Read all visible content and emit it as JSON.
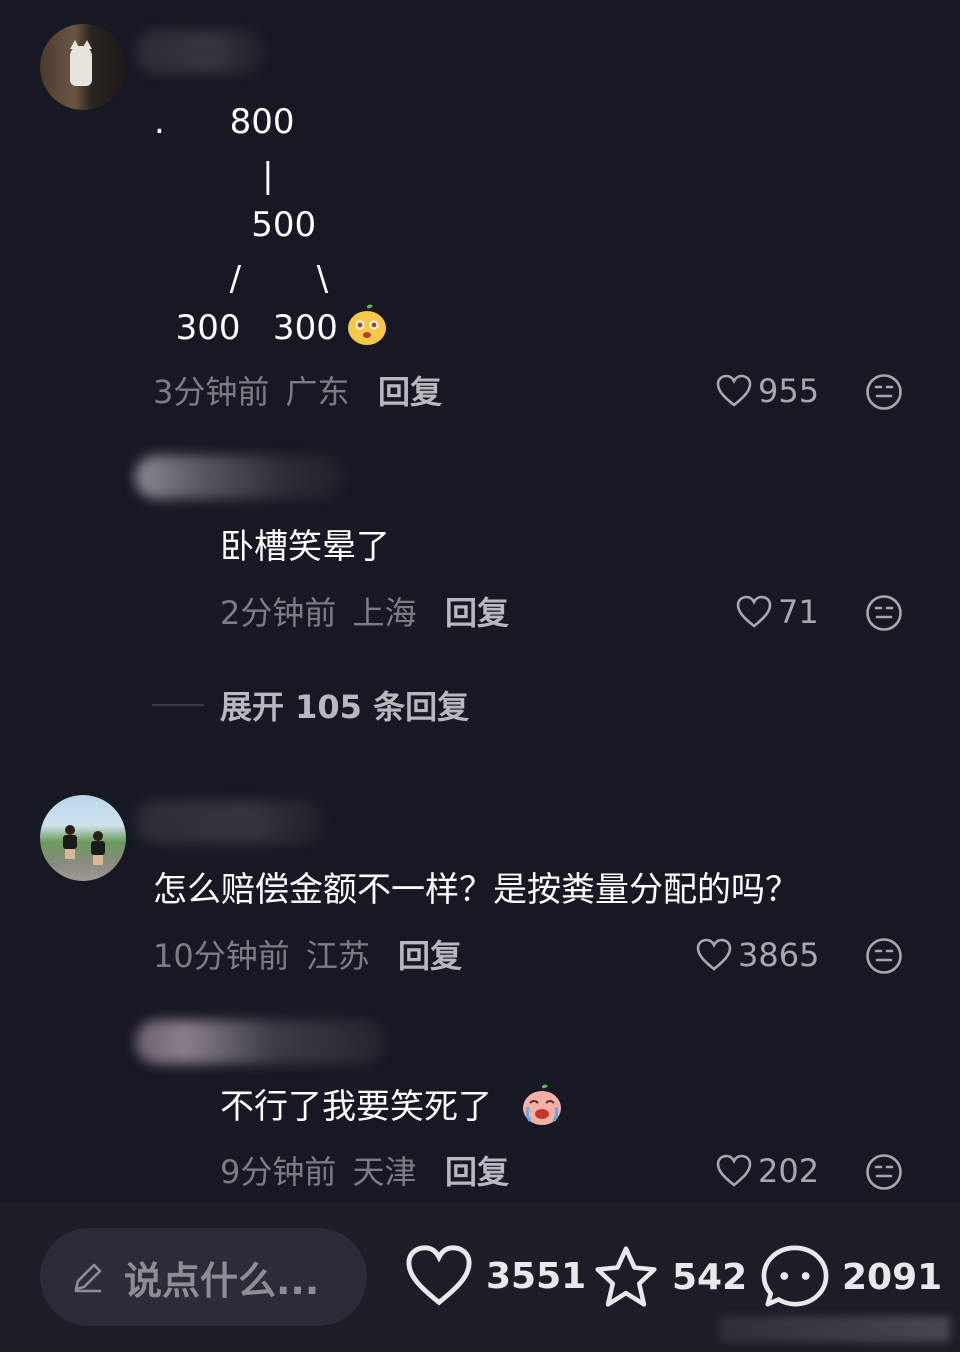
{
  "comments": [
    {
      "tree_lines": [
        ".      800",
        "          |",
        "         500",
        "       /       \\",
        "  300   300"
      ],
      "time": "3分钟前",
      "location": "广东",
      "reply_label": "回复",
      "likes": "955",
      "icons": {
        "like": "heart-icon",
        "emoji": "smiley-icon",
        "sticker": "cute-face-sticker-icon"
      }
    },
    {
      "text": "卧槽笑晕了",
      "time": "2分钟前",
      "location": "上海",
      "reply_label": "回复",
      "likes": "71"
    },
    {
      "expand_label": "展开 105 条回复"
    },
    {
      "text": "怎么赔偿金额不一样？是按粪量分配的吗？",
      "time": "10分钟前",
      "location": "江苏",
      "reply_label": "回复",
      "likes": "3865"
    },
    {
      "text": "不行了我要笑死了",
      "time": "9分钟前",
      "location": "天津",
      "reply_label": "回复",
      "likes": "202",
      "sticker": "laugh-cry-sticker-icon"
    }
  ],
  "bottom_bar": {
    "input_placeholder": "说点什么...",
    "likes": "3551",
    "favorites": "542",
    "comments": "2091",
    "icons": [
      "pencil-icon",
      "heart-icon",
      "star-icon",
      "chat-bubble-icon"
    ]
  },
  "colors": {
    "background": "#161823",
    "meta_text": "#7c7d84",
    "reply_text": "#b8b9be",
    "input_bg": "#2b2c37"
  }
}
